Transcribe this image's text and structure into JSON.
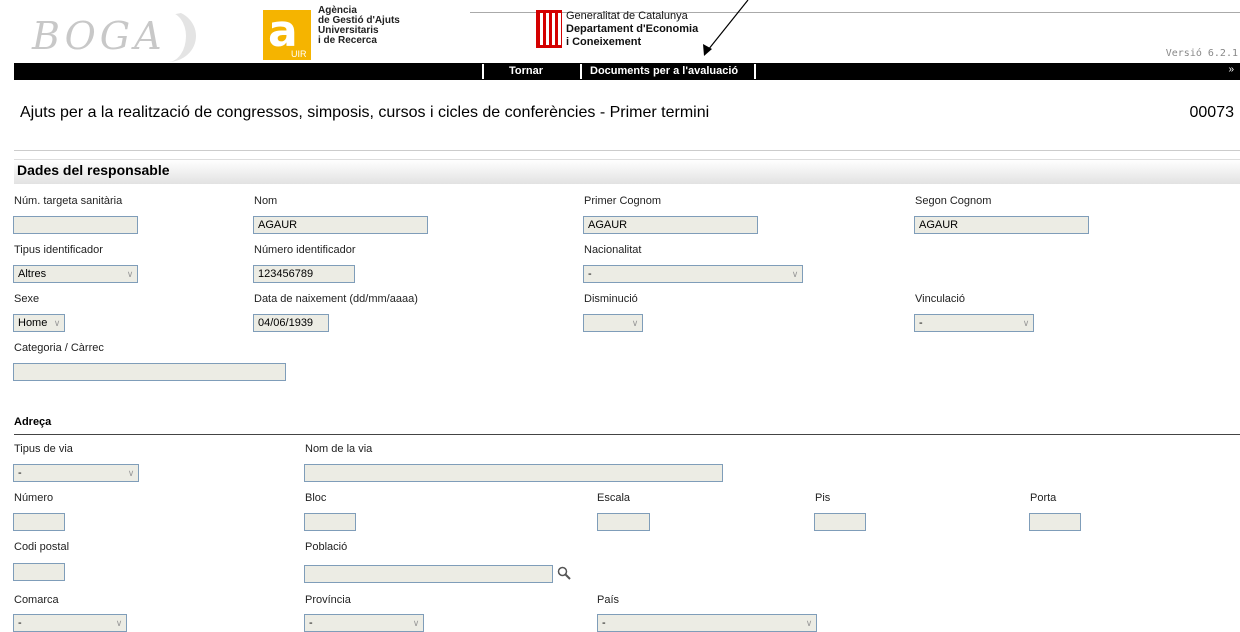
{
  "header": {
    "logo_text": "BOGA",
    "agency_lines": [
      "Agència",
      "de Gestió d'Ajuts",
      "Universitaris",
      "i de Recerca"
    ],
    "agency_badge": "UIR",
    "agency_letter": "a",
    "gov_lines": [
      "Generalitat de Catalunya",
      "Departament d'Economia",
      "i Coneixement"
    ],
    "version": "Versió 6.2.1"
  },
  "nav": {
    "items": [
      "Tornar",
      "Documents per a l'avaluació"
    ],
    "more": "»"
  },
  "page": {
    "title": "Ajuts per a la realització de congressos, simposis, cursos i cicles de conferències - Primer termini",
    "record_id": "00073"
  },
  "section": {
    "title": "Dades del responsable"
  },
  "fields": {
    "tsi": {
      "label": "Núm. targeta sanitària",
      "value": ""
    },
    "nom": {
      "label": "Nom",
      "value": "AGAUR"
    },
    "cognom1": {
      "label": "Primer Cognom",
      "value": "AGAUR"
    },
    "cognom2": {
      "label": "Segon Cognom",
      "value": "AGAUR"
    },
    "tipus_id": {
      "label": "Tipus identificador",
      "value": "Altres"
    },
    "num_id": {
      "label": "Número identificador",
      "value": "123456789"
    },
    "nacionalitat": {
      "label": "Nacionalitat",
      "value": "-"
    },
    "sexe": {
      "label": "Sexe",
      "value": "Home"
    },
    "data_naix": {
      "label": "Data de naixement (dd/mm/aaaa)",
      "value": "04/06/1939"
    },
    "disminucio": {
      "label": "Disminució",
      "value": ""
    },
    "vinculacio": {
      "label": "Vinculació",
      "value": "-"
    },
    "categoria": {
      "label": "Categoria / Càrrec",
      "value": ""
    }
  },
  "address": {
    "title": "Adreça",
    "tipus_via": {
      "label": "Tipus de via",
      "value": "-"
    },
    "nom_via": {
      "label": "Nom de la via",
      "value": ""
    },
    "numero": {
      "label": "Número",
      "value": ""
    },
    "bloc": {
      "label": "Bloc",
      "value": ""
    },
    "escala": {
      "label": "Escala",
      "value": ""
    },
    "pis": {
      "label": "Pis",
      "value": ""
    },
    "porta": {
      "label": "Porta",
      "value": ""
    },
    "codi_postal": {
      "label": "Codi postal",
      "value": ""
    },
    "poblacio": {
      "label": "Població",
      "value": ""
    },
    "comarca": {
      "label": "Comarca",
      "value": "-"
    },
    "provincia": {
      "label": "Província",
      "value": "-"
    },
    "pais": {
      "label": "País",
      "value": "-"
    }
  },
  "icons": {
    "dropdown": "chevron-down-icon",
    "search": "magnifier-icon"
  },
  "colors": {
    "field_bg": "#ecece4",
    "field_border": "#7f9db9",
    "navbar": "#000000",
    "agency": "#f5b400",
    "gov": "#d40000"
  }
}
